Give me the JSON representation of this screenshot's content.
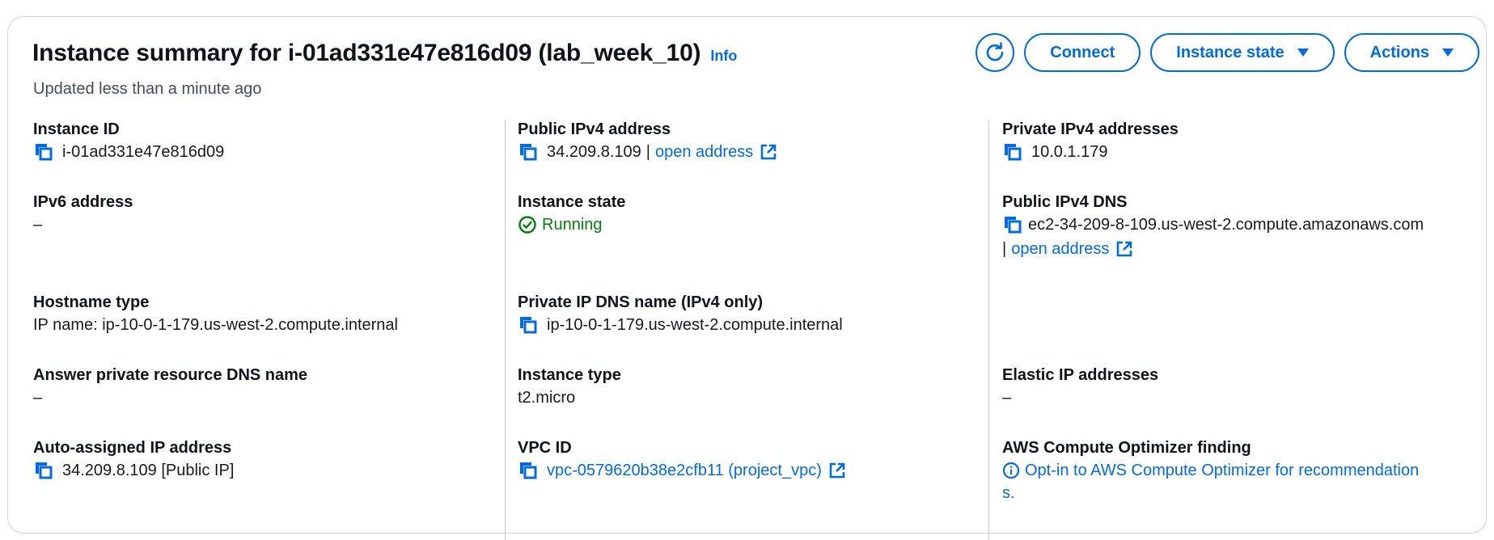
{
  "header": {
    "title": "Instance summary for i-01ad331e47e816d09 (lab_week_10)",
    "info_link": "Info",
    "subtitle": "Updated less than a minute ago",
    "buttons": {
      "connect": "Connect",
      "instance_state": "Instance state",
      "actions": "Actions"
    }
  },
  "details": {
    "instance_id": {
      "label": "Instance ID",
      "value": "i-01ad331e47e816d09"
    },
    "ipv6_address": {
      "label": "IPv6 address",
      "value": "–"
    },
    "hostname_type": {
      "label": "Hostname type",
      "value": "IP name: ip-10-0-1-179.us-west-2.compute.internal"
    },
    "answer_private_dns": {
      "label": "Answer private resource DNS name",
      "value": "–"
    },
    "auto_assigned_ip": {
      "label": "Auto-assigned IP address",
      "value": "34.209.8.109 [Public IP]"
    },
    "public_ipv4": {
      "label": "Public IPv4 address",
      "value": "34.209.8.109",
      "separator": "|",
      "link": "open address"
    },
    "instance_state": {
      "label": "Instance state",
      "value": "Running"
    },
    "private_ip_dns": {
      "label": "Private IP DNS name (IPv4 only)",
      "value": "ip-10-0-1-179.us-west-2.compute.internal"
    },
    "instance_type": {
      "label": "Instance type",
      "value": "t2.micro"
    },
    "vpc_id": {
      "label": "VPC ID",
      "value": "vpc-0579620b38e2cfb11 (project_vpc)"
    },
    "private_ipv4": {
      "label": "Private IPv4 addresses",
      "value": "10.0.1.179"
    },
    "public_ipv4_dns": {
      "label": "Public IPv4 DNS",
      "value": "ec2-34-209-8-109.us-west-2.compute.amazonaws.com",
      "separator": "|",
      "link": "open address"
    },
    "elastic_ip": {
      "label": "Elastic IP addresses",
      "value": "–"
    },
    "compute_optimizer": {
      "label": "AWS Compute Optimizer finding",
      "link_line1": "Opt-in to AWS Compute Optimizer for recommendation",
      "link_line2": "s."
    }
  },
  "colors": {
    "link": "#006ce0",
    "running": "#037f0c",
    "text": "#16191f",
    "border": "#d1d5db"
  }
}
